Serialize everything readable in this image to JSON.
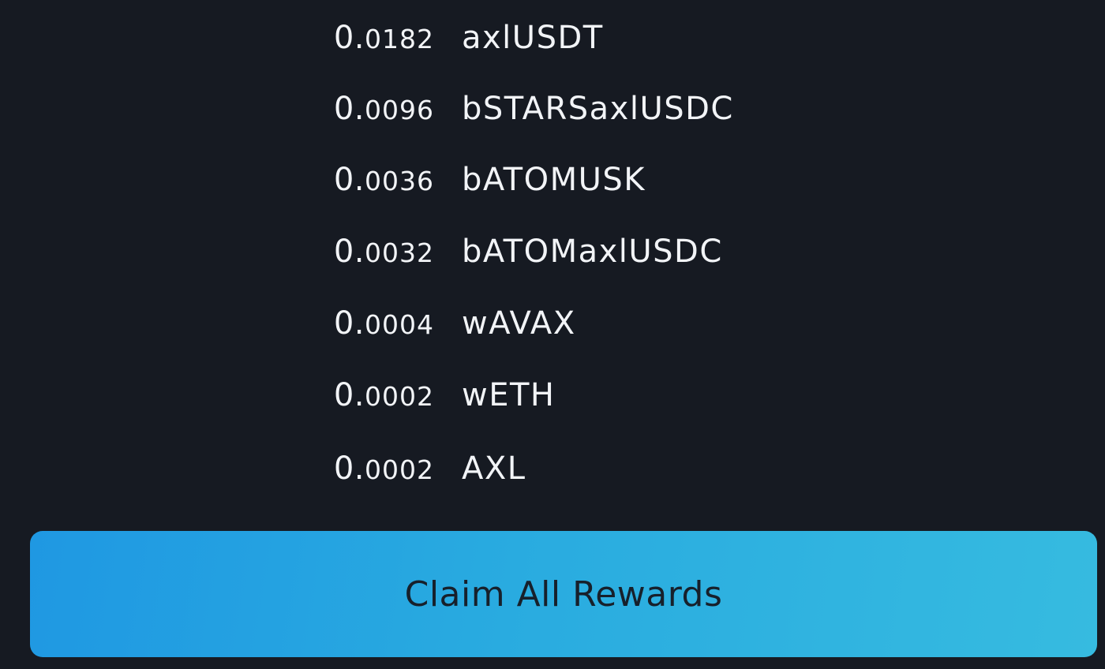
{
  "rewards": [
    {
      "amount_int": "0.",
      "amount_frac": "0182",
      "token": "axlUSDT"
    },
    {
      "amount_int": "0.",
      "amount_frac": "0096",
      "token": "bSTARSaxlUSDC"
    },
    {
      "amount_int": "0.",
      "amount_frac": "0036",
      "token": "bATOMUSK"
    },
    {
      "amount_int": "0.",
      "amount_frac": "0032",
      "token": "bATOMaxlUSDC"
    },
    {
      "amount_int": "0.",
      "amount_frac": "0004",
      "token": "wAVAX"
    },
    {
      "amount_int": "0.",
      "amount_frac": "0002",
      "token": "wETH"
    },
    {
      "amount_int": "0.",
      "amount_frac": "0002",
      "token": "AXL"
    }
  ],
  "claim_button": {
    "label": "Claim All Rewards"
  },
  "colors": {
    "background": "#161a22",
    "text": "#f2f4f7",
    "button_gradient_start": "#1f98e2",
    "button_gradient_end": "#36bbe0",
    "button_text": "#17202b"
  }
}
